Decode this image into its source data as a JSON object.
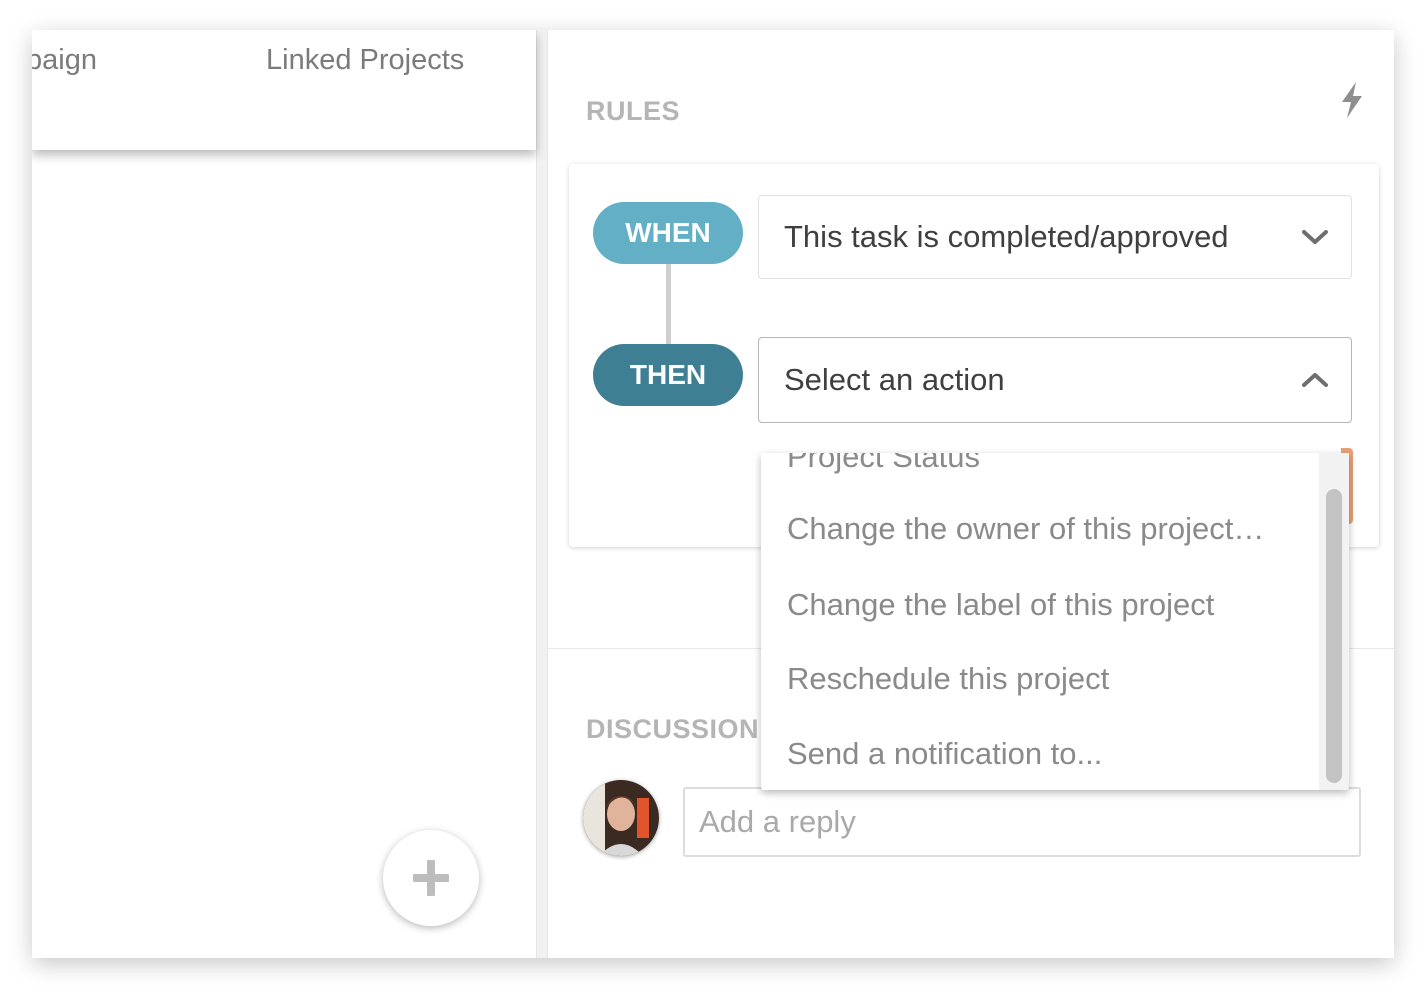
{
  "left": {
    "tabs": [
      {
        "label": "paign"
      },
      {
        "label": "Linked Projects"
      }
    ],
    "add_button_icon": "plus-icon"
  },
  "rules": {
    "title": "RULES",
    "icon": "lightning-bolt-icon",
    "when_label": "WHEN",
    "then_label": "THEN",
    "when_select_value": "This task is completed/approved",
    "then_select_value": "Select an action",
    "dropdown_options": [
      "Project Status",
      "Change the owner of this project…",
      "Change the label of this project",
      "Reschedule this project",
      "Send a notification to..."
    ]
  },
  "discussion": {
    "title": "DISCUSSION",
    "reply_placeholder": "Add a reply"
  },
  "colors": {
    "when_pill": "#62afc6",
    "then_pill": "#3e7f93",
    "accent_button": "#e9a079"
  }
}
